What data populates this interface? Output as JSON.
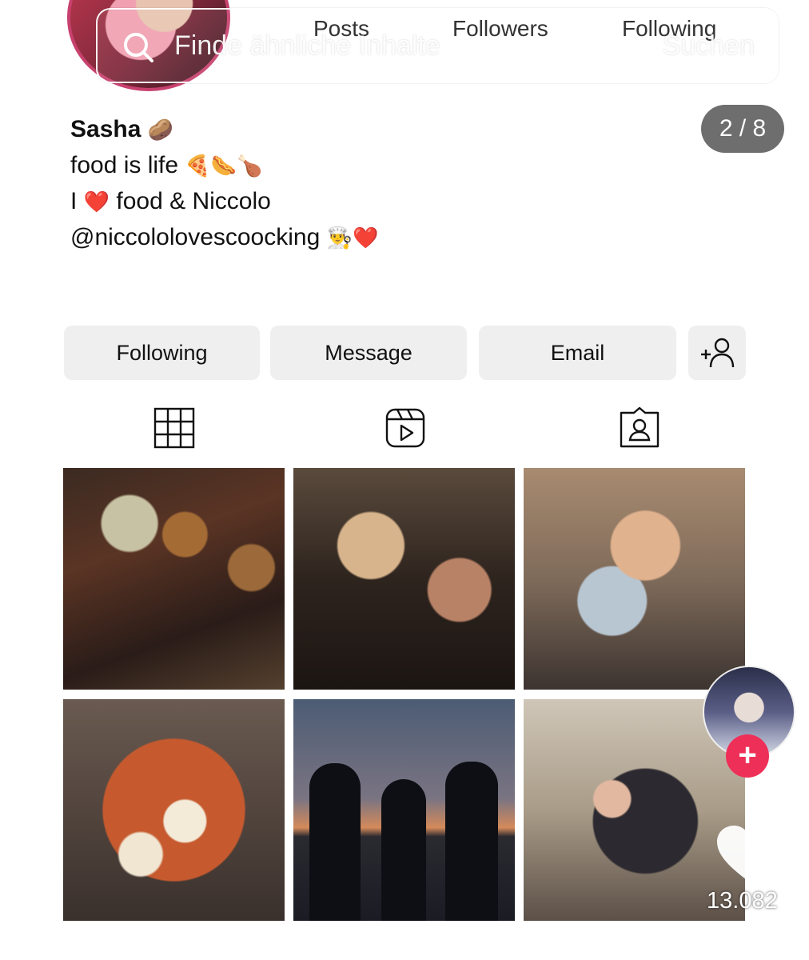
{
  "profile": {
    "stats": {
      "posts_label": "Posts",
      "followers_label": "Followers",
      "following_label": "Following"
    },
    "bio": {
      "name": "Sasha",
      "name_emoji": "🥔",
      "line1": "food is life",
      "line1_emoji": "🍕🌭🍗",
      "line2_prefix": "I",
      "line2_heart": "❤️",
      "line2_suffix": "food & Niccolo",
      "line3": "@niccololovescoocking",
      "line3_emoji": "👨‍🍳❤️"
    },
    "actions": {
      "following": "Following",
      "message": "Message",
      "email": "Email"
    },
    "tabs": [
      "grid-icon",
      "reels-icon",
      "tagged-icon"
    ]
  },
  "overlay": {
    "search_placeholder": "Finde ähnliche Inhalte",
    "search_submit": "Suchen",
    "counter": "2 / 8",
    "like_count": "13.082"
  },
  "colors": {
    "accent_red": "#ee2f57",
    "button_bg": "#efefef",
    "counter_bg": "#6e6e6e"
  },
  "grid_posts": [
    {
      "id": "post-food-platter"
    },
    {
      "id": "post-couple-laughing"
    },
    {
      "id": "post-kitchen-hug"
    },
    {
      "id": "post-pizza"
    },
    {
      "id": "post-sunset-silhouettes"
    },
    {
      "id": "post-friends-group"
    }
  ]
}
